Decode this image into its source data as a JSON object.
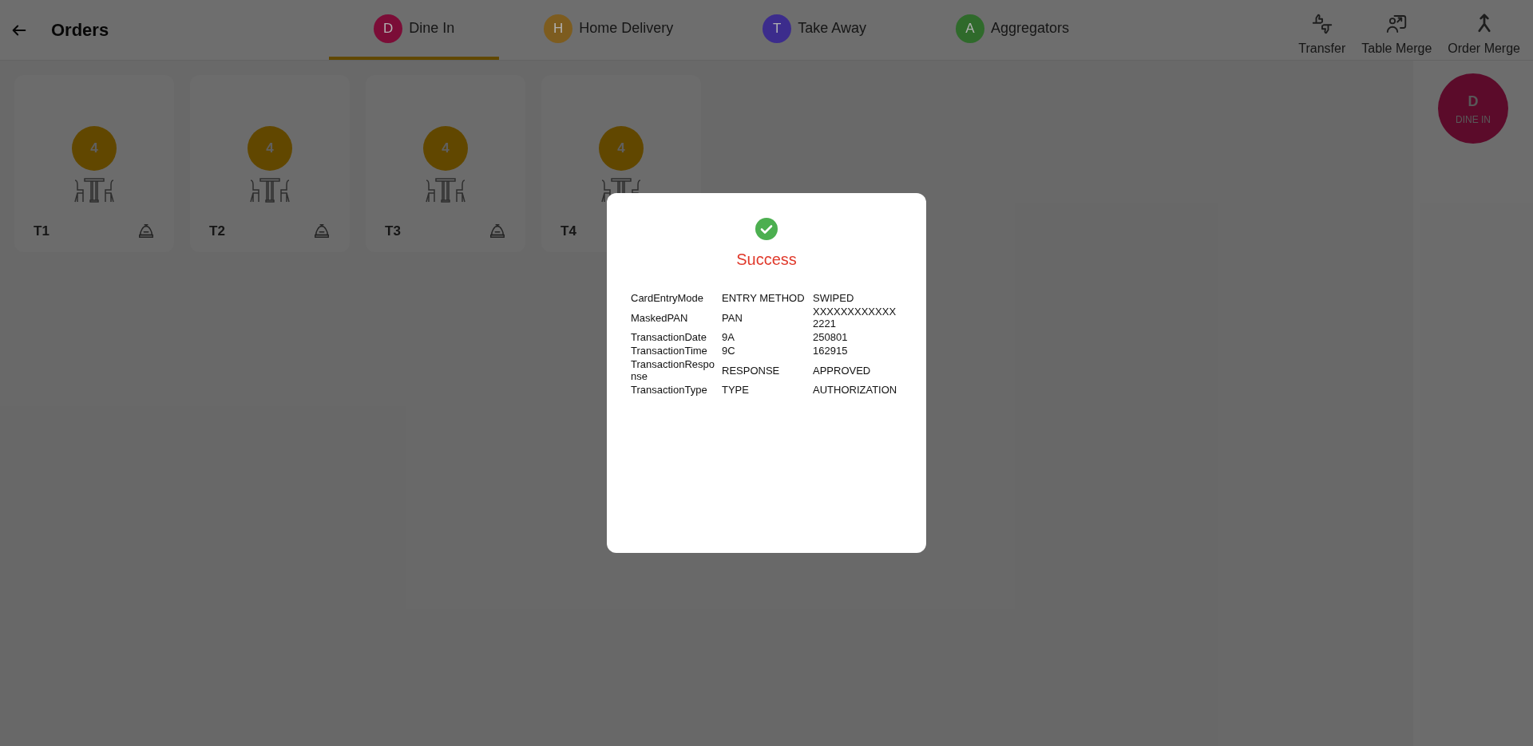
{
  "header": {
    "title": "Orders"
  },
  "tabs": [
    {
      "letter": "D",
      "label": "Dine In",
      "color": "#7b0d37",
      "selected": true
    },
    {
      "letter": "H",
      "label": "Home Delivery",
      "color": "#7d5c1f",
      "selected": false
    },
    {
      "letter": "T",
      "label": "Take Away",
      "color": "#3c2c8c",
      "selected": false
    },
    {
      "letter": "A",
      "label": "Aggregators",
      "color": "#2f6a2b",
      "selected": false
    }
  ],
  "actions": [
    {
      "kind": "transfer",
      "label": "Transfer"
    },
    {
      "kind": "table_merge",
      "label": "Table Merge"
    },
    {
      "kind": "order_merge",
      "label": "Order Merge"
    }
  ],
  "tables": [
    {
      "name": "T1",
      "seats": "4"
    },
    {
      "name": "T2",
      "seats": "4"
    },
    {
      "name": "T3",
      "seats": "4"
    },
    {
      "name": "T4",
      "seats": "4"
    }
  ],
  "side_badge": {
    "letter": "D",
    "label": "DINE IN"
  },
  "dialog": {
    "title": "Success",
    "rows": [
      [
        "CardEntryMode",
        "ENTRY METHOD",
        "SWIPED"
      ],
      [
        "MaskedPAN",
        "PAN",
        "XXXXXXXXXXXX2221"
      ],
      [
        "TransactionDate",
        "9A",
        "250801"
      ],
      [
        "TransactionTime",
        "9C",
        "162915"
      ],
      [
        "TransactionResponse",
        "RESPONSE",
        "APPROVED"
      ],
      [
        "TransactionType",
        "TYPE",
        "AUTHORIZATION"
      ]
    ]
  }
}
